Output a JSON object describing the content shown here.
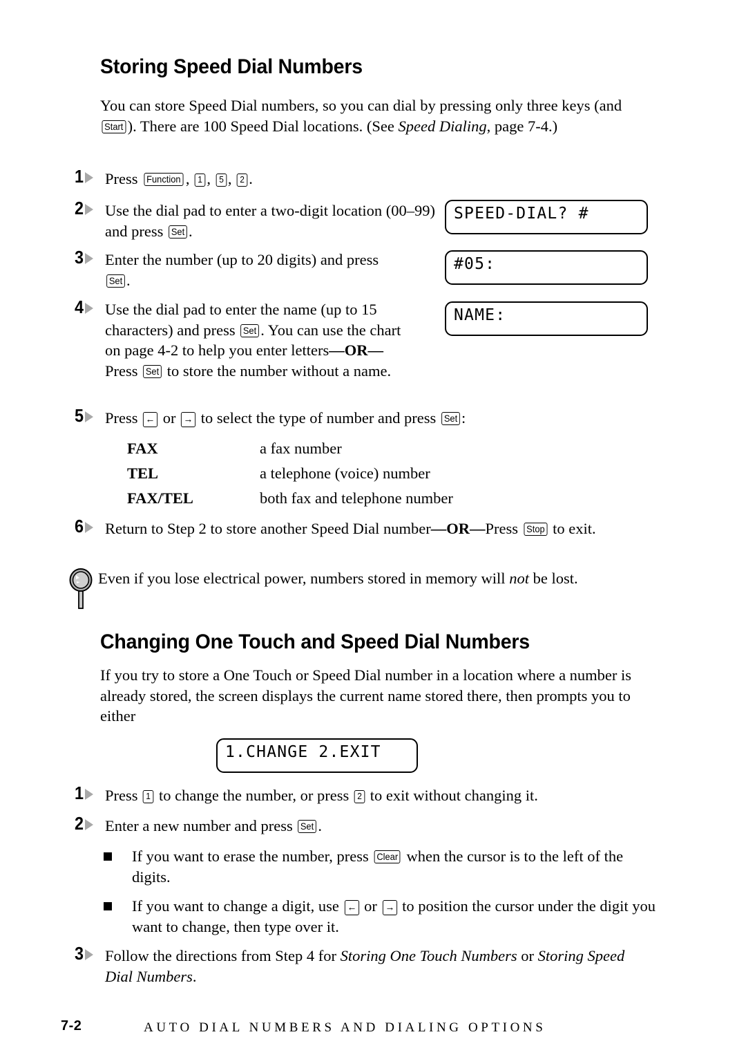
{
  "document": {
    "page_number": "7-2",
    "footer_title": "AUTO DIAL NUMBERS AND DIALING OPTIONS"
  },
  "sections": [
    {
      "heading": "Storing Speed Dial Numbers",
      "intro": {
        "part1": "You can store Speed Dial numbers, so you can dial by pressing only three keys (and ",
        "key1": "Start",
        "part2": "). There are 100 Speed Dial locations. (See ",
        "italic1": "Speed Dialing",
        "part3": ", page 7-4.)"
      },
      "steps": [
        {
          "number": "1",
          "t1": "Press ",
          "k1": "Function",
          "t2": ", ",
          "k2": "1",
          "t3": ", ",
          "k3": "5",
          "t4": ", ",
          "k4": "2",
          "t5": "."
        },
        {
          "number": "2",
          "t1": "Use the dial pad to enter a two-digit location (00–99) and press ",
          "k1": "Set",
          "t2": "."
        },
        {
          "number": "3",
          "t1": "Enter the number (up to 20 digits) and press ",
          "k1": "Set",
          "t2": "."
        },
        {
          "number": "4",
          "t1": "Use the dial pad to enter the name (up to 15 characters) and press ",
          "k1": "Set",
          "t2": ". You can use the chart on page 4-2 to help you enter letters",
          "or_label": "—OR—",
          "t3": "Press ",
          "k2": "Set",
          "t4": " to store the number without a name."
        },
        {
          "number": "5",
          "t1": "Press ",
          "k1": "←",
          "t2": " or ",
          "k2": "→",
          "t3": " to select the type of number and press ",
          "k3": "Set",
          "t4": ":"
        },
        {
          "number": "6",
          "t1": "Return to Step 2 to store another Speed Dial number",
          "or_label": "—OR—",
          "t2": "Press ",
          "k1": "Stop",
          "t3": " to exit."
        }
      ],
      "number_types": [
        {
          "term": "FAX",
          "desc": "a fax number"
        },
        {
          "term": "TEL",
          "desc": "a telephone (voice) number"
        },
        {
          "term": "FAX/TEL",
          "desc": "both fax and telephone number"
        }
      ],
      "note": {
        "icon": "magnifier-icon",
        "t1": "Even if you lose electrical power, numbers stored in memory will ",
        "italic1": "not",
        "t2": " be lost."
      },
      "lcd_displays": [
        {
          "name": "lcd-speed-dial-prompt",
          "text": "SPEED-DIAL? #"
        },
        {
          "name": "lcd-number-entry",
          "text": "#05:"
        },
        {
          "name": "lcd-name-entry",
          "text": "NAME:"
        }
      ]
    },
    {
      "heading": "Changing One Touch and Speed Dial Numbers",
      "intro": "If you try to store a One Touch or Speed Dial number in a location where a number is already stored, the screen displays the current name stored there, then prompts you to either",
      "lcd_display": {
        "name": "lcd-change-exit-prompt",
        "text": "1.CHANGE 2.EXIT"
      },
      "steps": [
        {
          "number": "1",
          "t1": "Press ",
          "k1": "1",
          "t2": " to change the number, or press ",
          "k2": "2",
          "t3": " to exit without changing it."
        },
        {
          "number": "2",
          "t1": "Enter a new number and press ",
          "k1": "Set",
          "t2": "."
        },
        {
          "number": "3",
          "t1": "Follow the directions from Step 4 for ",
          "italic1": "Storing One Touch Numbers",
          "t2": " or ",
          "italic2": "Storing Speed Dial Numbers",
          "t3": "."
        }
      ],
      "bullets": [
        {
          "t1": "If you want to erase the number, press ",
          "k1": "Clear",
          "t2": " when the cursor is to the left of the digits."
        },
        {
          "t1": "If you want to change a digit, use ",
          "k1": "←",
          "t2": " or ",
          "k2": "→",
          "t3": " to position the cursor under the digit you want to change, then type over it."
        }
      ]
    }
  ]
}
